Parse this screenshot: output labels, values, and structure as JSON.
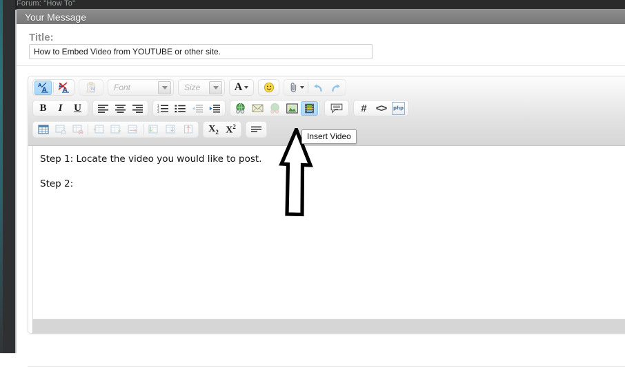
{
  "window": {
    "breadcrumb": "Forum: \"How To\"",
    "panel_title": "Your Message"
  },
  "form": {
    "title_label": "Title:",
    "title_value": "How to Embed Video from YOUTUBE or other site.",
    "title_placeholder": "Title"
  },
  "editor": {
    "font_select": {
      "label": "Font",
      "icon": "chevron-down-icon"
    },
    "size_select": {
      "label": "Size",
      "icon": "chevron-down-icon"
    },
    "rows": [
      {
        "name": "toolbar-row-1",
        "groups": [
          {
            "name": "formatting-source-group",
            "buttons": [
              {
                "name": "toggle-wysiwyg-button",
                "icon": "a-over-a-icon",
                "glyph": "A̲",
                "state": "active",
                "enabled": true
              },
              {
                "name": "remove-format-button",
                "icon": "strikethrough-a-icon",
                "glyph": "A̶",
                "state": "normal",
                "enabled": true
              }
            ]
          },
          {
            "name": "paste-word-group",
            "buttons": [
              {
                "name": "paste-from-word-button",
                "icon": "clipboard-word-icon",
                "glyph": "ὌB",
                "state": "disabled",
                "enabled": false
              }
            ]
          },
          {
            "name": "text-color-group",
            "buttons": [
              {
                "name": "text-color-button",
                "icon": "font-color-icon",
                "glyph": "A",
                "state": "normal",
                "enabled": true
              }
            ]
          },
          {
            "name": "emoticon-group",
            "buttons": [
              {
                "name": "insert-emoticon-button",
                "icon": "smiley-icon",
                "glyph": "☺",
                "state": "normal",
                "enabled": true
              }
            ]
          },
          {
            "name": "attach-undo-group",
            "buttons": [
              {
                "name": "attach-file-button",
                "icon": "paperclip-icon",
                "glyph": "ὌE",
                "state": "normal",
                "enabled": true
              },
              {
                "name": "undo-button",
                "icon": "undo-arrow-icon",
                "glyph": "↶",
                "state": "normal",
                "enabled": true
              },
              {
                "name": "redo-button",
                "icon": "redo-arrow-icon",
                "glyph": "↷",
                "state": "normal",
                "enabled": true
              }
            ]
          }
        ]
      },
      {
        "name": "toolbar-row-2",
        "groups": [
          {
            "name": "basic-style-group",
            "buttons": [
              {
                "name": "bold-button",
                "icon": "bold-icon",
                "glyph": "B",
                "state": "normal",
                "enabled": true
              },
              {
                "name": "italic-button",
                "icon": "italic-icon",
                "glyph": "I",
                "state": "normal",
                "enabled": true
              },
              {
                "name": "underline-button",
                "icon": "underline-icon",
                "glyph": "U",
                "state": "normal",
                "enabled": true
              }
            ]
          },
          {
            "name": "alignment-group",
            "buttons": [
              {
                "name": "align-left-button",
                "icon": "align-left-icon",
                "glyph": "",
                "state": "normal",
                "enabled": true
              },
              {
                "name": "align-center-button",
                "icon": "align-center-icon",
                "glyph": "",
                "state": "normal",
                "enabled": true
              },
              {
                "name": "align-right-button",
                "icon": "align-right-icon",
                "glyph": "",
                "state": "normal",
                "enabled": true
              }
            ]
          },
          {
            "name": "list-indent-group",
            "buttons": [
              {
                "name": "numbered-list-button",
                "icon": "ordered-list-icon",
                "glyph": "",
                "state": "normal",
                "enabled": true
              },
              {
                "name": "bullet-list-button",
                "icon": "unordered-list-icon",
                "glyph": "",
                "state": "normal",
                "enabled": true
              },
              {
                "name": "outdent-button",
                "icon": "outdent-icon",
                "glyph": "",
                "state": "disabled",
                "enabled": false
              },
              {
                "name": "indent-button",
                "icon": "indent-icon",
                "glyph": "",
                "state": "normal",
                "enabled": true
              }
            ]
          },
          {
            "name": "media-group",
            "buttons": [
              {
                "name": "insert-link-button",
                "icon": "globe-link-icon",
                "glyph": "",
                "state": "normal",
                "enabled": true
              },
              {
                "name": "insert-email-button",
                "icon": "envelope-icon",
                "glyph": "",
                "state": "normal",
                "enabled": true
              },
              {
                "name": "remove-link-button",
                "icon": "broken-globe-icon",
                "glyph": "",
                "state": "faded",
                "enabled": true
              },
              {
                "name": "insert-image-button",
                "icon": "picture-icon",
                "glyph": "",
                "state": "normal",
                "enabled": true
              },
              {
                "name": "insert-video-button",
                "icon": "film-strip-icon",
                "glyph": "",
                "state": "active",
                "enabled": true
              }
            ]
          },
          {
            "name": "quote-group",
            "buttons": [
              {
                "name": "insert-quote-button",
                "icon": "speech-bubble-icon",
                "glyph": "",
                "state": "normal",
                "enabled": true
              }
            ]
          },
          {
            "name": "code-group",
            "buttons": [
              {
                "name": "insert-hash-button",
                "icon": "hash-icon",
                "glyph": "#",
                "state": "normal",
                "enabled": true
              },
              {
                "name": "insert-code-button",
                "icon": "angle-brackets-icon",
                "glyph": "<>",
                "state": "normal",
                "enabled": true
              },
              {
                "name": "insert-php-button",
                "icon": "php-file-icon",
                "glyph": "php",
                "state": "normal",
                "enabled": true
              }
            ]
          }
        ]
      },
      {
        "name": "toolbar-row-3",
        "groups": [
          {
            "name": "table-group",
            "buttons": [
              {
                "name": "insert-table-button",
                "icon": "table-icon",
                "glyph": "",
                "state": "normal",
                "enabled": true
              },
              {
                "name": "table-properties-button",
                "icon": "table-properties-icon",
                "glyph": "",
                "state": "disabled",
                "enabled": false
              },
              {
                "name": "delete-table-button",
                "icon": "table-delete-icon",
                "glyph": "",
                "state": "disabled",
                "enabled": false
              },
              {
                "name": "insert-row-button",
                "icon": "table-row-insert-icon",
                "glyph": "",
                "state": "disabled",
                "enabled": false
              },
              {
                "name": "merge-cells-button",
                "icon": "table-cell-merge-icon",
                "glyph": "",
                "state": "disabled",
                "enabled": false
              },
              {
                "name": "split-cell-button",
                "icon": "table-cell-split-icon",
                "glyph": "",
                "state": "disabled",
                "enabled": false
              },
              {
                "name": "insert-column-left-button",
                "icon": "table-column-left-icon",
                "glyph": "",
                "state": "disabled",
                "enabled": false
              },
              {
                "name": "insert-column-right-button",
                "icon": "table-column-right-icon",
                "glyph": "",
                "state": "disabled",
                "enabled": false
              },
              {
                "name": "delete-column-button",
                "icon": "table-column-delete-icon",
                "glyph": "",
                "state": "disabled",
                "enabled": false
              }
            ]
          },
          {
            "name": "script-group",
            "buttons": [
              {
                "name": "subscript-button",
                "icon": "subscript-icon",
                "glyph": "X2",
                "state": "normal",
                "enabled": true
              },
              {
                "name": "superscript-button",
                "icon": "superscript-icon",
                "glyph": "X2",
                "state": "normal",
                "enabled": true
              }
            ]
          },
          {
            "name": "horizontal-rule-group",
            "buttons": [
              {
                "name": "horizontal-rule-button",
                "icon": "horizontal-rule-icon",
                "glyph": "",
                "state": "normal",
                "enabled": true
              }
            ]
          }
        ]
      }
    ],
    "message_lines": [
      "Step 1: Locate the video you would like to post.",
      "",
      "Step 2:"
    ]
  },
  "tooltip": {
    "text": "Insert Video"
  },
  "annotation": {
    "shape": "up-arrow",
    "color": "#000000",
    "points_to": "insert-video-button"
  },
  "colors": {
    "accent_active": "#a8d6f7",
    "panel_header": "#828282",
    "chrome_dark": "#2b2b2b",
    "rail_teal": "#2e7480",
    "text": "#111111",
    "muted_text": "#8f8f8f"
  }
}
